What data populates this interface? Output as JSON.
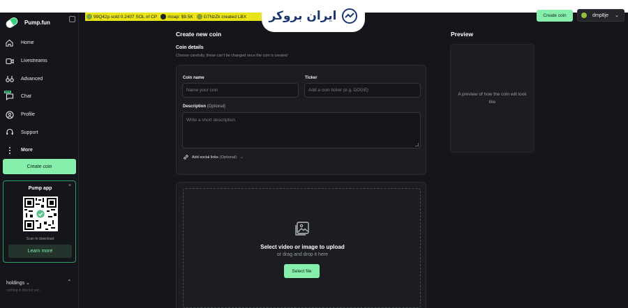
{
  "brand": {
    "name": "Pump.fun"
  },
  "sidebar": {
    "items": [
      {
        "label": "Home",
        "icon": "home-icon"
      },
      {
        "label": "Livestreams",
        "icon": "video-icon"
      },
      {
        "label": "Advanced",
        "icon": "advanced-icon"
      },
      {
        "label": "Chat",
        "icon": "chat-icon",
        "badge": "NEW"
      },
      {
        "label": "Profile",
        "icon": "profile-icon"
      },
      {
        "label": "Support",
        "icon": "headset-icon"
      },
      {
        "label": "More",
        "icon": "more-icon"
      }
    ],
    "create_label": "Create coin",
    "app_card": {
      "title": "Pump app",
      "close": "×",
      "scan_text": "Scan to download",
      "learn_label": "Learn more"
    },
    "holdings": {
      "label": "holdings",
      "chevron": "⌄",
      "sub": "nothing in this list yet...",
      "toggle": "⌃"
    }
  },
  "ticker": {
    "segments": [
      {
        "text": "99Q42p sold 0.2407 SOL of CP",
        "avatar_color": "#7aa63a"
      },
      {
        "text": "mcap: $9.5K",
        "avatar_color": "#222222"
      },
      {
        "text": "G7NzZk created LBX",
        "avatar_color": "#8a9a30"
      }
    ]
  },
  "watermark": {
    "text": "ایران بروکر"
  },
  "header": {
    "create_label": "Create coin",
    "user": {
      "name": "dmp8je",
      "chevron": "⌄"
    }
  },
  "main": {
    "title": "Create new coin",
    "section_title": "Coin details",
    "section_sub": "Choose carefully, these can't be changed once the coin is created",
    "coin_name": {
      "label": "Coin name",
      "placeholder": "Name your coin"
    },
    "ticker": {
      "label": "Ticker",
      "placeholder": "Add a coin ticker (e.g. DOGE)"
    },
    "description": {
      "label": "Description",
      "optional": "(Optional)",
      "placeholder": "Write a short description"
    },
    "social": {
      "label": "Add social links",
      "optional": "(Optional)",
      "chevron": "⌄"
    },
    "upload": {
      "title": "Select video or image to upload",
      "sub": "or drag and drop it here",
      "button": "Select file"
    }
  },
  "preview": {
    "title": "Preview",
    "text": "A preview of how the coin will look like"
  },
  "colors": {
    "accent": "#86efac",
    "background": "#15161b",
    "card": "#1b1d22",
    "ticker": "#e8e418"
  }
}
